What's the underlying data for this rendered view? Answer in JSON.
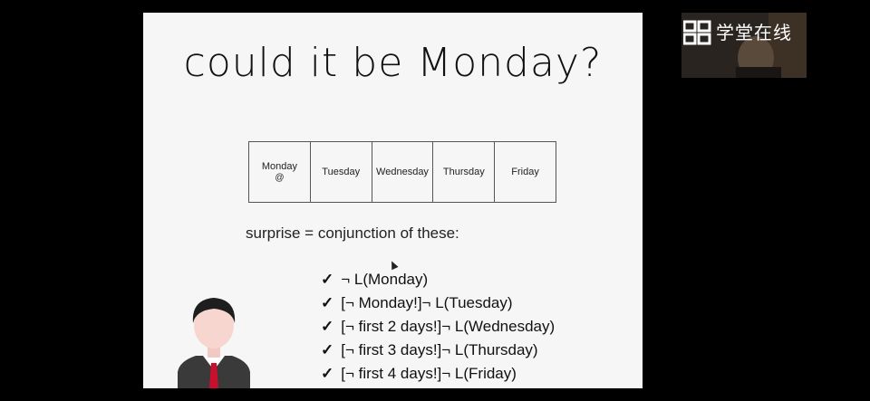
{
  "slide": {
    "title": "could it be Monday?",
    "days": [
      {
        "label": "Monday",
        "mark": "@"
      },
      {
        "label": "Tuesday",
        "mark": ""
      },
      {
        "label": "Wednesday",
        "mark": ""
      },
      {
        "label": "Thursday",
        "mark": ""
      },
      {
        "label": "Friday",
        "mark": ""
      }
    ],
    "surprise_text": "surprise = conjunction of these:",
    "check_symbol": "✓",
    "clauses": [
      "¬ L(Monday)",
      "[¬ Monday!]¬ L(Tuesday)",
      "[¬ first 2 days!]¬ L(Wednesday)",
      "[¬ first 3 days!]¬ L(Thursday)",
      "[¬ first 4 days!]¬ L(Friday)"
    ]
  },
  "watermark": {
    "text": "学堂在线"
  },
  "colors": {
    "background": "#000000",
    "slide_bg": "#f6f6f6",
    "tie": "#c8102e"
  }
}
